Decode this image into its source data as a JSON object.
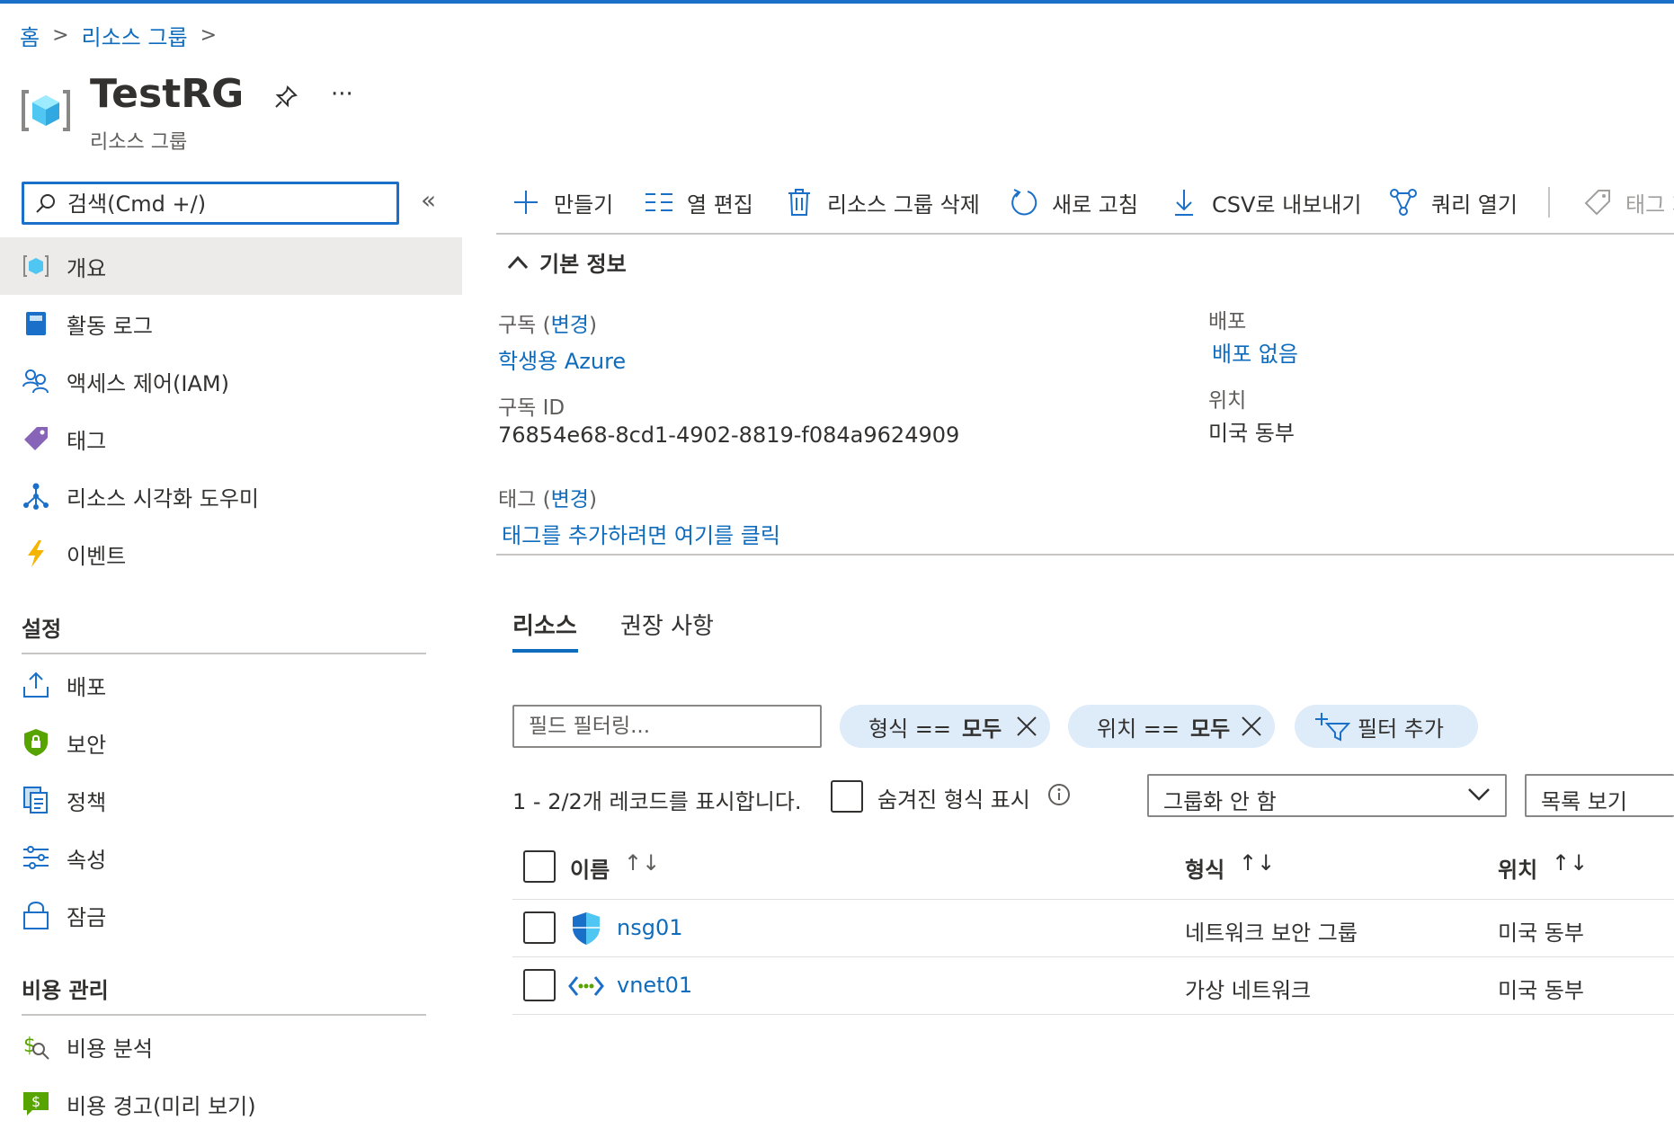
{
  "breadcrumb": {
    "home": "홈",
    "resource_groups": "리소스 그룹",
    "separator": ">"
  },
  "header": {
    "title": "TestRG",
    "subtitle": "리소스 그룹",
    "pin_icon": "pin-icon",
    "more": "···"
  },
  "sidebar": {
    "search_placeholder": "검색(Cmd +/)",
    "collapse": "«",
    "items": [
      {
        "label": "개요",
        "icon": "resource-group-icon",
        "active": true
      },
      {
        "label": "활동 로그",
        "icon": "activity-log-icon"
      },
      {
        "label": "액세스 제어(IAM)",
        "icon": "people-icon"
      },
      {
        "label": "태그",
        "icon": "tag-icon"
      },
      {
        "label": "리소스 시각화 도우미",
        "icon": "visualizer-icon"
      },
      {
        "label": "이벤트",
        "icon": "lightning-icon"
      }
    ],
    "settings_heading": "설정",
    "settings_items": [
      {
        "label": "배포",
        "icon": "upload-icon"
      },
      {
        "label": "보안",
        "icon": "shield-lock-icon"
      },
      {
        "label": "정책",
        "icon": "policy-icon"
      },
      {
        "label": "속성",
        "icon": "sliders-icon"
      },
      {
        "label": "잠금",
        "icon": "lock-icon"
      }
    ],
    "cost_heading": "비용 관리",
    "cost_items": [
      {
        "label": "비용 분석",
        "icon": "cost-analysis-icon"
      },
      {
        "label": "비용 경고(미리 보기)",
        "icon": "cost-alert-icon"
      }
    ]
  },
  "toolbar": {
    "create": "만들기",
    "edit_columns": "열 편집",
    "delete_group": "리소스 그룹 삭제",
    "refresh": "새로 고침",
    "export_csv": "CSV로 내보내기",
    "open_query": "쿼리 열기",
    "tags": "태그 지"
  },
  "essentials": {
    "heading": "기본 정보",
    "subscription_label": "구독",
    "change": "변경",
    "subscription_value": "학생용 Azure",
    "subscription_id_label": "구독 ID",
    "subscription_id": "76854e68-8cd1-4902-8819-f084a9624909",
    "tags_label": "태그",
    "tags_link": "태그를 추가하려면 여기를 클릭",
    "deployments_label": "배포",
    "deployments_value": "배포 없음",
    "location_label": "위치",
    "location_value": "미국 동부"
  },
  "tabs": {
    "resources": "리소스",
    "recommendations": "권장 사항"
  },
  "filters": {
    "field_placeholder": "필드 필터링...",
    "type_pill_key": "형식 ==",
    "type_pill_value": "모두",
    "location_pill_key": "위치 ==",
    "location_pill_value": "모두",
    "add_filter": "필터 추가"
  },
  "records": {
    "summary": "1 - 2/2개 레코드를 표시합니다.",
    "show_hidden": "숨겨진 형식 표시",
    "grouping": "그룹화 안 함",
    "view": "목록 보기"
  },
  "table": {
    "columns": [
      "이름",
      "형식",
      "위치"
    ],
    "sort_name": "↑↓",
    "sort_other": "↑↓",
    "rows": [
      {
        "name": "nsg01",
        "type": "네트워크 보안 그룹",
        "location": "미국 동부",
        "icon": "network-security-group-icon"
      },
      {
        "name": "vnet01",
        "type": "가상 네트워크",
        "location": "미국 동부",
        "icon": "virtual-network-icon"
      }
    ]
  }
}
